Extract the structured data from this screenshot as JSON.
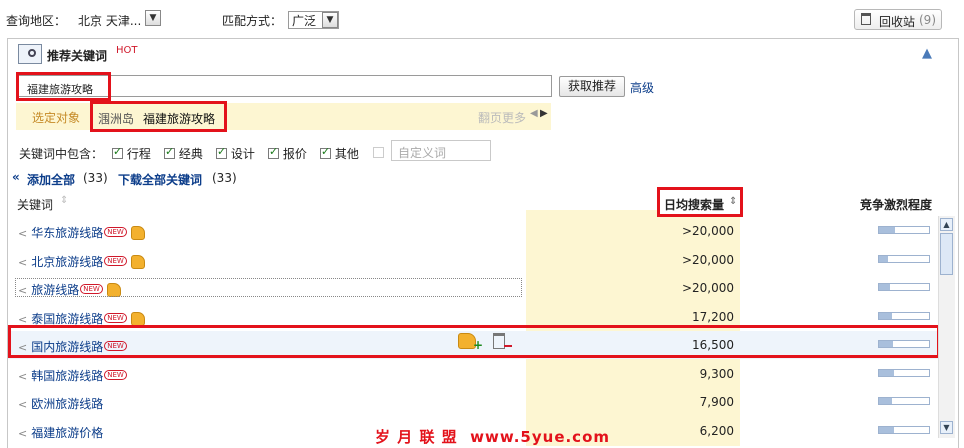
{
  "top": {
    "region_label": "查询地区：",
    "region_value": "北京 天津...",
    "match_label": "匹配方式：",
    "match_value": "广泛",
    "recycle_label": "回收站",
    "recycle_count": "(9)"
  },
  "panel": {
    "title": "推荐关键词",
    "hot": "HOT",
    "search_value": "福建旅游攻略",
    "get_button": "获取推荐",
    "advanced": "高级",
    "selected_label": "选定对象",
    "selected_items": [
      "涠洲岛",
      "福建旅游攻略"
    ],
    "more_pages": "翻页更多",
    "contains_label": "关键词中包含：",
    "filters": [
      {
        "label": "行程",
        "checked": true
      },
      {
        "label": "经典",
        "checked": true
      },
      {
        "label": "设计",
        "checked": true
      },
      {
        "label": "报价",
        "checked": true
      },
      {
        "label": "其他",
        "checked": true
      }
    ],
    "custom_placeholder": "自定义词",
    "add_all": "添加全部",
    "add_all_count": "(33)",
    "download_all": "下载全部关键词",
    "download_count": "(33)",
    "col_keyword": "关键词",
    "col_volume": "日均搜索量",
    "col_competition": "竞争激烈程度"
  },
  "rows": [
    {
      "keyword": "华东旅游线路",
      "new": true,
      "thumb": true,
      "volume": ">20,000",
      "competition": 0.32
    },
    {
      "keyword": "北京旅游线路",
      "new": true,
      "thumb": true,
      "volume": ">20,000",
      "competition": 0.18
    },
    {
      "keyword": "旅游线路",
      "new": true,
      "thumb": true,
      "volume": ">20,000",
      "competition": 0.22
    },
    {
      "keyword": "泰国旅游线路",
      "new": true,
      "thumb": true,
      "volume": "17,200",
      "competition": 0.25
    },
    {
      "keyword": "国内旅游线路",
      "new": true,
      "thumb": false,
      "volume": "16,500",
      "competition": 0.28
    },
    {
      "keyword": "韩国旅游线路",
      "new": true,
      "thumb": false,
      "volume": "9,300",
      "competition": 0.3
    },
    {
      "keyword": "欧洲旅游线路",
      "new": false,
      "thumb": false,
      "volume": "7,900",
      "competition": 0.26
    },
    {
      "keyword": "福建旅游价格",
      "new": false,
      "thumb": false,
      "volume": "6,200",
      "competition": 0.3
    }
  ],
  "new_badge": "NEW",
  "watermark": "岁 月 联 盟  www.5yue.com"
}
